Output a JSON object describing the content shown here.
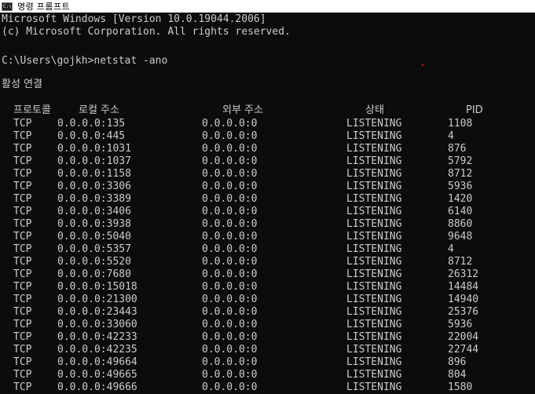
{
  "window": {
    "title": "명령 프롬프트",
    "icon": "cmd-icon"
  },
  "console": {
    "banner_line1": "Microsoft Windows [Version 10.0.19044.2006]",
    "banner_line2": "(c) Microsoft Corporation. All rights reserved.",
    "prompt": "C:\\Users\\gojkh>netstat -ano",
    "section_title": "활성 연결",
    "headers": {
      "proto": "프로토콜",
      "local": "로컬 주소",
      "foreign": "외부 주소",
      "state": "상태",
      "pid": "PID"
    },
    "connections": [
      {
        "proto": "TCP",
        "local": "0.0.0.0:135",
        "foreign": "0.0.0.0:0",
        "state": "LISTENING",
        "pid": "1108"
      },
      {
        "proto": "TCP",
        "local": "0.0.0.0:445",
        "foreign": "0.0.0.0:0",
        "state": "LISTENING",
        "pid": "4"
      },
      {
        "proto": "TCP",
        "local": "0.0.0.0:1031",
        "foreign": "0.0.0.0:0",
        "state": "LISTENING",
        "pid": "876"
      },
      {
        "proto": "TCP",
        "local": "0.0.0.0:1037",
        "foreign": "0.0.0.0:0",
        "state": "LISTENING",
        "pid": "5792"
      },
      {
        "proto": "TCP",
        "local": "0.0.0.0:1158",
        "foreign": "0.0.0.0:0",
        "state": "LISTENING",
        "pid": "8712"
      },
      {
        "proto": "TCP",
        "local": "0.0.0.0:3306",
        "foreign": "0.0.0.0:0",
        "state": "LISTENING",
        "pid": "5936"
      },
      {
        "proto": "TCP",
        "local": "0.0.0.0:3389",
        "foreign": "0.0.0.0:0",
        "state": "LISTENING",
        "pid": "1420"
      },
      {
        "proto": "TCP",
        "local": "0.0.0.0:3406",
        "foreign": "0.0.0.0:0",
        "state": "LISTENING",
        "pid": "6140"
      },
      {
        "proto": "TCP",
        "local": "0.0.0.0:3938",
        "foreign": "0.0.0.0:0",
        "state": "LISTENING",
        "pid": "8860"
      },
      {
        "proto": "TCP",
        "local": "0.0.0.0:5040",
        "foreign": "0.0.0.0:0",
        "state": "LISTENING",
        "pid": "9648"
      },
      {
        "proto": "TCP",
        "local": "0.0.0.0:5357",
        "foreign": "0.0.0.0:0",
        "state": "LISTENING",
        "pid": "4"
      },
      {
        "proto": "TCP",
        "local": "0.0.0.0:5520",
        "foreign": "0.0.0.0:0",
        "state": "LISTENING",
        "pid": "8712"
      },
      {
        "proto": "TCP",
        "local": "0.0.0.0:7680",
        "foreign": "0.0.0.0:0",
        "state": "LISTENING",
        "pid": "26312"
      },
      {
        "proto": "TCP",
        "local": "0.0.0.0:15018",
        "foreign": "0.0.0.0:0",
        "state": "LISTENING",
        "pid": "14484"
      },
      {
        "proto": "TCP",
        "local": "0.0.0.0:21300",
        "foreign": "0.0.0.0:0",
        "state": "LISTENING",
        "pid": "14940"
      },
      {
        "proto": "TCP",
        "local": "0.0.0.0:23443",
        "foreign": "0.0.0.0:0",
        "state": "LISTENING",
        "pid": "25376"
      },
      {
        "proto": "TCP",
        "local": "0.0.0.0:33060",
        "foreign": "0.0.0.0:0",
        "state": "LISTENING",
        "pid": "5936"
      },
      {
        "proto": "TCP",
        "local": "0.0.0.0:42233",
        "foreign": "0.0.0.0:0",
        "state": "LISTENING",
        "pid": "22004"
      },
      {
        "proto": "TCP",
        "local": "0.0.0.0:42235",
        "foreign": "0.0.0.0:0",
        "state": "LISTENING",
        "pid": "22744"
      },
      {
        "proto": "TCP",
        "local": "0.0.0.0:49664",
        "foreign": "0.0.0.0:0",
        "state": "LISTENING",
        "pid": "896"
      },
      {
        "proto": "TCP",
        "local": "0.0.0.0:49665",
        "foreign": "0.0.0.0:0",
        "state": "LISTENING",
        "pid": "804"
      },
      {
        "proto": "TCP",
        "local": "0.0.0.0:49666",
        "foreign": "0.0.0.0:0",
        "state": "LISTENING",
        "pid": "1580"
      }
    ]
  },
  "colors": {
    "background": "#0c0c0c",
    "text": "#cccccc",
    "titlebar": "#ffffff"
  }
}
